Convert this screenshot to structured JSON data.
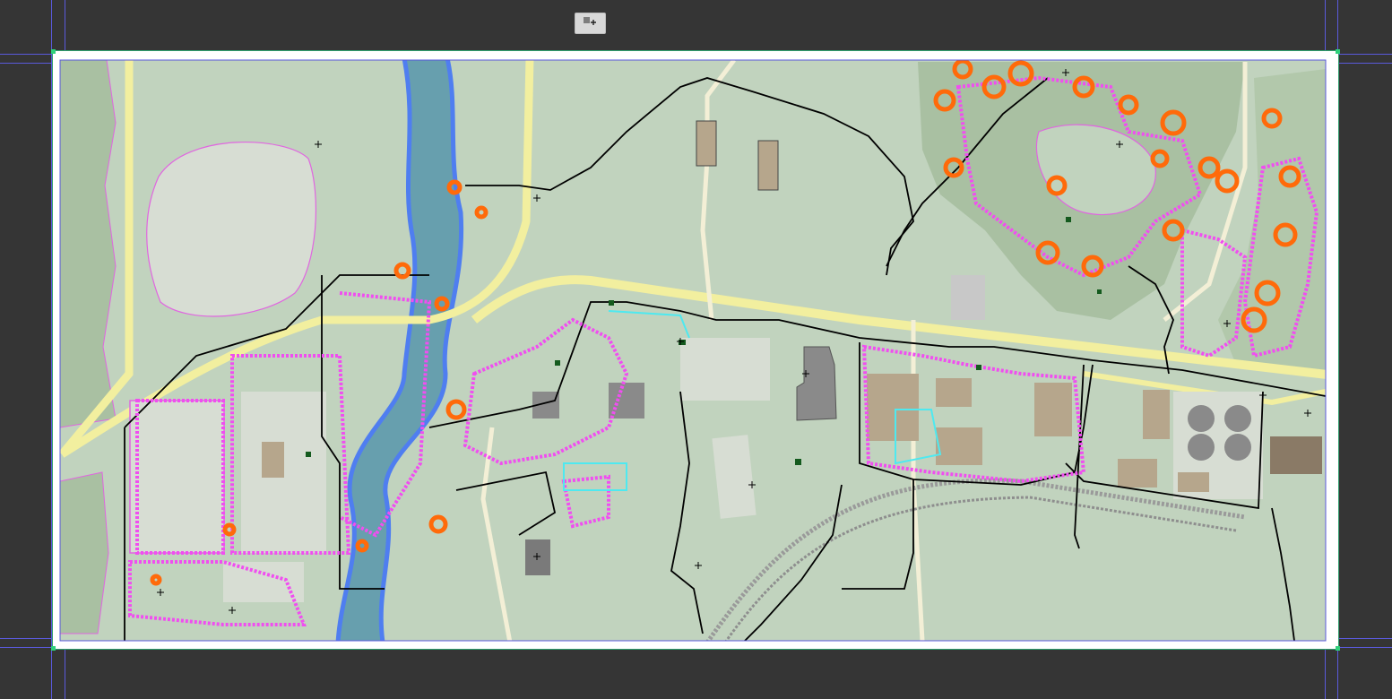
{
  "app": {
    "name": "",
    "toolbar_icon": "selection-tool-icon"
  },
  "colors": {
    "workspace": "#353535",
    "artboard": "#ffffff",
    "land": "#c1d3be",
    "field": "#d7ddd3",
    "woodland": "#a9c0a2",
    "water": "#679fae",
    "water_edge": "#4f7ef0",
    "road": "#f2ef9f",
    "path": "#f3efd6",
    "building": "#b6a68c",
    "building_dark": "#7a7a7a",
    "anchor_magenta": "#f04ef0",
    "anchor_orange": "#ff6a0a",
    "anchor_cyan": "#4ee9f0",
    "selection_black": "#000000",
    "guide": "#5a5adc"
  },
  "map": {
    "layers": [
      "land",
      "woodland",
      "water",
      "roads",
      "paths",
      "buildings",
      "tree-clusters",
      "selection-anchors"
    ],
    "features": [
      "river",
      "west-road",
      "main-road",
      "north-road",
      "east-road",
      "railway",
      "north-loop-path",
      "west-pond",
      "parking-lot",
      "water-treatment-tanks",
      "industrial-buildings",
      "forest-cluster"
    ]
  }
}
